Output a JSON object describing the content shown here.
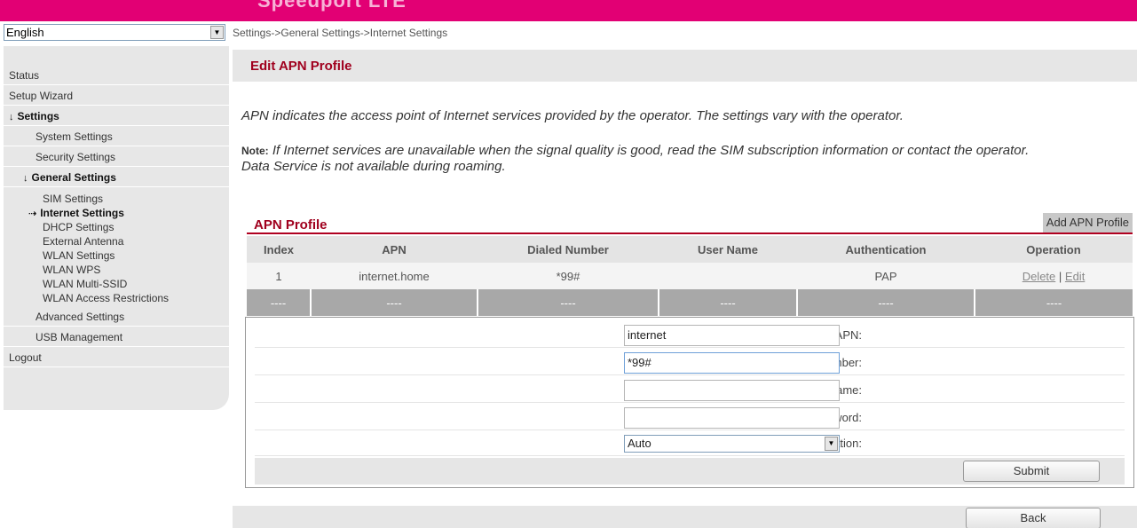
{
  "header": {
    "brand": "Speedport LTE"
  },
  "language": {
    "selected": "English"
  },
  "breadcrumb": "Settings->General Settings->Internet Settings",
  "sidebar": {
    "status": "Status",
    "setup_wizard": "Setup Wizard",
    "settings": "Settings",
    "system_settings": "System Settings",
    "security_settings": "Security Settings",
    "general_settings": "General Settings",
    "sim_settings": "SIM Settings",
    "internet_settings": "Internet Settings",
    "dhcp_settings": "DHCP Settings",
    "external_antenna": "External Antenna",
    "wlan_settings": "WLAN Settings",
    "wlan_wps": "WLAN WPS",
    "wlan_multi_ssid": "WLAN Multi-SSID",
    "wlan_access_restrictions": "WLAN Access Restrictions",
    "advanced_settings": "Advanced Settings",
    "usb_management": "USB Management",
    "logout": "Logout"
  },
  "page": {
    "title": "Edit APN Profile",
    "description": "APN indicates the access point of Internet services provided by the operator. The settings vary with the operator.",
    "note_label": "Note:",
    "note_text": " If Internet services are unavailable when the signal quality is good, read the SIM subscription information or contact the operator.",
    "roaming_text": "Data Service is not available during roaming."
  },
  "apn_profile": {
    "title": "APN Profile",
    "add_button": "Add APN Profile",
    "columns": [
      "Index",
      "APN",
      "Dialed Number",
      "User Name",
      "Authentication",
      "Operation"
    ],
    "rows": [
      {
        "index": "1",
        "apn": "internet.home",
        "dialed": "*99#",
        "user": "",
        "auth": "PAP",
        "delete": "Delete",
        "sep": "|",
        "edit": "Edit"
      }
    ],
    "placeholder_row": [
      "----",
      "----",
      "----",
      "----",
      "----",
      "----"
    ]
  },
  "form": {
    "apn_label": "APN:",
    "apn_value": "internet",
    "dialed_label": "Dialed Number:",
    "dialed_value": "*99#",
    "user_label": "User Name:",
    "user_value": "",
    "password_label": "Password:",
    "password_value": "",
    "auth_label": "Authentication:",
    "auth_value": "Auto",
    "submit": "Submit"
  },
  "back": "Back",
  "colors": {
    "brand": "#e20074",
    "title": "#a0001e"
  }
}
